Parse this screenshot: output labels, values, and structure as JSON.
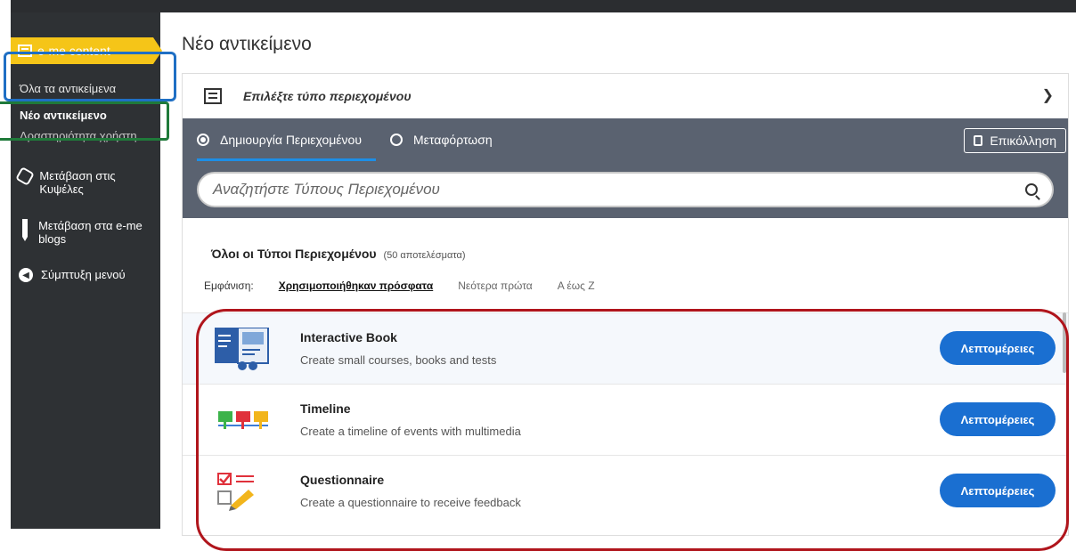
{
  "sidebar": {
    "header_label": "e-me content",
    "items": [
      "Όλα τα αντικείμενα",
      "Νέο αντικείμενο",
      "Δραστηριότητα χρήστη"
    ],
    "links": [
      {
        "label": "Μετάβαση στις Κυψέλες",
        "icon": "hexagon-icon"
      },
      {
        "label": "Μετάβαση στα e-me blogs",
        "icon": "pencil-icon"
      },
      {
        "label": "Σύμπτυξη μενού",
        "icon": "collapse-arrow-icon"
      }
    ]
  },
  "main": {
    "title": "Νέο αντικείμενο",
    "type_selector": "Επιλέξτε τύπο περιεχομένου",
    "tabs": [
      "Δημιουργία Περιεχομένου",
      "Μεταφόρτωση"
    ],
    "paste_label": "Επικόλληση",
    "search_placeholder": "Αναζητήστε Τύπους Περιεχομένου",
    "list_heading": "Όλοι οι Τύποι Περιεχομένου",
    "list_count": "(50 αποτελέσματα)",
    "sort_label": "Εμφάνιση:",
    "sort_options": [
      "Χρησιμοποιήθηκαν πρόσφατα",
      "Νεότερα πρώτα",
      "Α έως Ζ"
    ],
    "details_label": "Λεπτομέρειες",
    "content_types": [
      {
        "title": "Interactive Book",
        "desc": "Create small courses, books and tests",
        "icon": "interactive-book-icon"
      },
      {
        "title": "Timeline",
        "desc": "Create a timeline of events with multimedia",
        "icon": "timeline-icon"
      },
      {
        "title": "Questionnaire",
        "desc": "Create a questionnaire to receive feedback",
        "icon": "questionnaire-icon"
      }
    ]
  },
  "colors": {
    "accent_yellow": "#f5c518",
    "sidebar_bg": "#2e3134",
    "tabs_bg": "#5a6270",
    "button_blue": "#1a6fd1",
    "highlight_blue": "#1f6fc4",
    "highlight_green": "#1f7a3a",
    "highlight_red": "#b0151c"
  }
}
